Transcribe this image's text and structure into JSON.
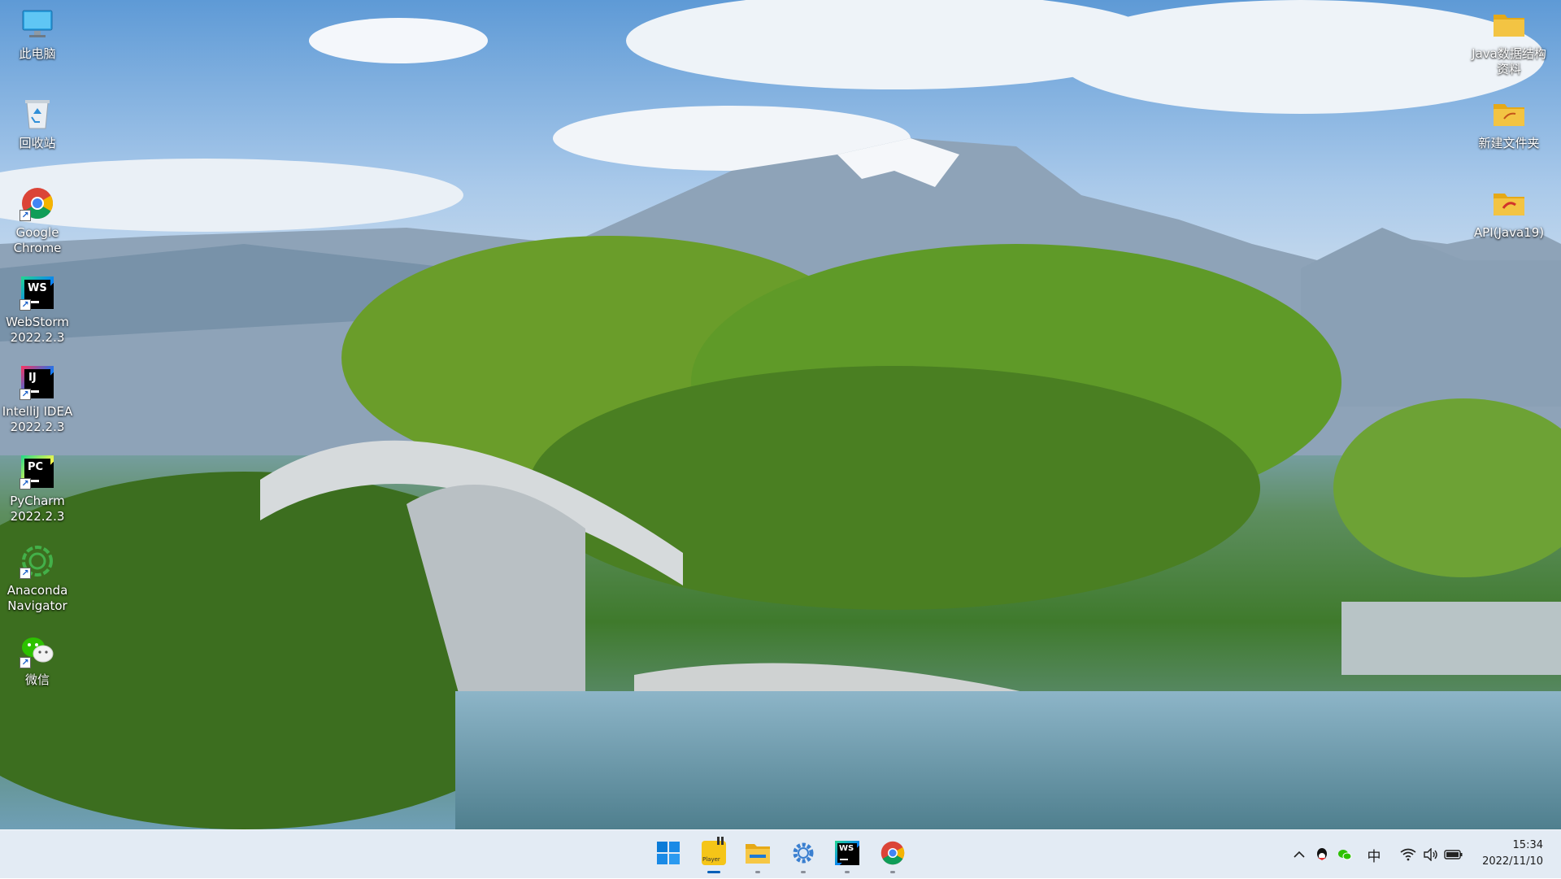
{
  "desktop": {
    "left_icons": [
      {
        "label": "此电脑",
        "icon": "computer-icon"
      },
      {
        "label": "回收站",
        "icon": "recycle-bin-icon"
      },
      {
        "label": "Google\nChrome",
        "icon": "chrome-icon"
      },
      {
        "label": "WebStorm\n2022.2.3",
        "icon": "webstorm-icon"
      },
      {
        "label": "IntelliJ IDEA\n2022.2.3",
        "icon": "intellij-icon"
      },
      {
        "label": "PyCharm\n2022.2.3",
        "icon": "pycharm-icon"
      },
      {
        "label": "Anaconda\nNavigator",
        "icon": "anaconda-icon"
      },
      {
        "label": "微信",
        "icon": "wechat-icon"
      }
    ],
    "right_icons": [
      {
        "label": "Java数据结构\n资料",
        "icon": "folder-icon"
      },
      {
        "label": "新建文件夹",
        "icon": "folder-icon"
      },
      {
        "label": "API(Java19)",
        "icon": "folder-icon"
      }
    ]
  },
  "taskbar": {
    "apps": [
      {
        "name": "start",
        "icon": "windows-start-icon",
        "indicator": "none"
      },
      {
        "name": "player",
        "icon": "potplayer-icon",
        "label": "Player",
        "indicator": "active"
      },
      {
        "name": "file-explorer",
        "icon": "file-explorer-icon",
        "indicator": "open"
      },
      {
        "name": "settings",
        "icon": "settings-gear-icon",
        "indicator": "open"
      },
      {
        "name": "webstorm",
        "icon": "webstorm-icon",
        "label": "WS",
        "indicator": "open"
      },
      {
        "name": "chrome",
        "icon": "chrome-icon",
        "indicator": "open"
      }
    ],
    "tray": {
      "overflow_icon": "chevron-up-icon",
      "ime_label": "中",
      "icons": [
        "qq-icon",
        "wechat-icon",
        "wifi-icon",
        "volume-icon",
        "battery-icon"
      ]
    },
    "clock": {
      "time": "15:34",
      "date": "2022/11/10"
    }
  },
  "colors": {
    "taskbar_bg": "#e2eaf4",
    "accent": "#005fb8",
    "folder_yellow": "#f3c443"
  }
}
